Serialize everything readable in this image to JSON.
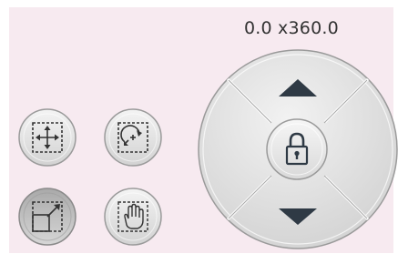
{
  "readout": {
    "size_text": "0.0 x360.0"
  },
  "theme": {
    "panel_bg": "#f7eaf0",
    "button_face": "#e4e4e4",
    "button_border": "#9a9a9a",
    "active_button_face": "#bfbfbf",
    "icon_color": "#333333"
  },
  "tools": [
    {
      "name": "move",
      "icon": "move-arrows-icon",
      "active": false
    },
    {
      "name": "rotate",
      "icon": "rotate-icon",
      "active": false
    },
    {
      "name": "resize",
      "icon": "resize-icon",
      "active": true
    },
    {
      "name": "pan",
      "icon": "hand-icon",
      "active": false
    }
  ],
  "dial": {
    "up_icon": "triangle-up-icon",
    "down_icon": "triangle-down-icon",
    "center_icon": "lock-icon"
  }
}
